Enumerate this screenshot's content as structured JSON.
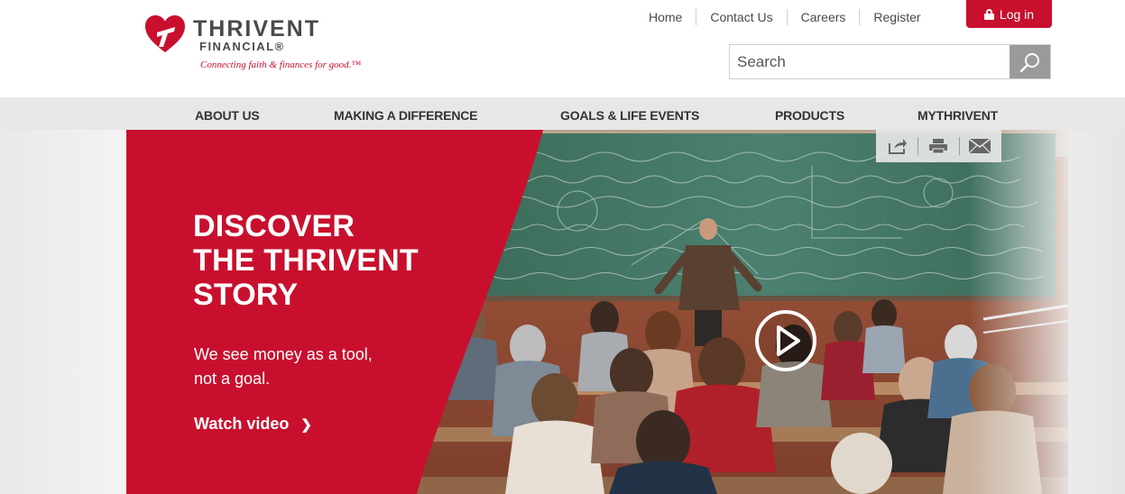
{
  "header": {
    "brand_name": "THRIVENT",
    "brand_sub": "FINANCIAL®",
    "tagline": "Connecting faith & finances for good.™",
    "logo_icon": "heart-cross-logo-icon",
    "utility_links": [
      "Home",
      "Contact Us",
      "Careers",
      "Register"
    ],
    "login_label": "Log in",
    "login_icon": "lock-icon",
    "search": {
      "placeholder": "Search",
      "button_icon": "search-icon"
    }
  },
  "main_nav": {
    "items": [
      "ABOUT US",
      "MAKING A DIFFERENCE",
      "GOALS & LIFE EVENTS",
      "PRODUCTS",
      "MYTHRIVENT"
    ]
  },
  "hero": {
    "title_lines": [
      "DISCOVER",
      "THE THRIVENT",
      "STORY"
    ],
    "subtitle_lines": [
      "We see money as a tool,",
      "not a goal."
    ],
    "cta_label": "Watch video",
    "cta_icon": "chevron-right-icon",
    "play_icon": "play-icon",
    "share_icons": [
      "share-icon",
      "print-icon",
      "email-icon"
    ]
  },
  "colors": {
    "brand_red": "#c8102e",
    "nav_bg": "#e7e7e7",
    "text_dark": "#4a4a4a",
    "search_button": "#9a9a9a"
  }
}
